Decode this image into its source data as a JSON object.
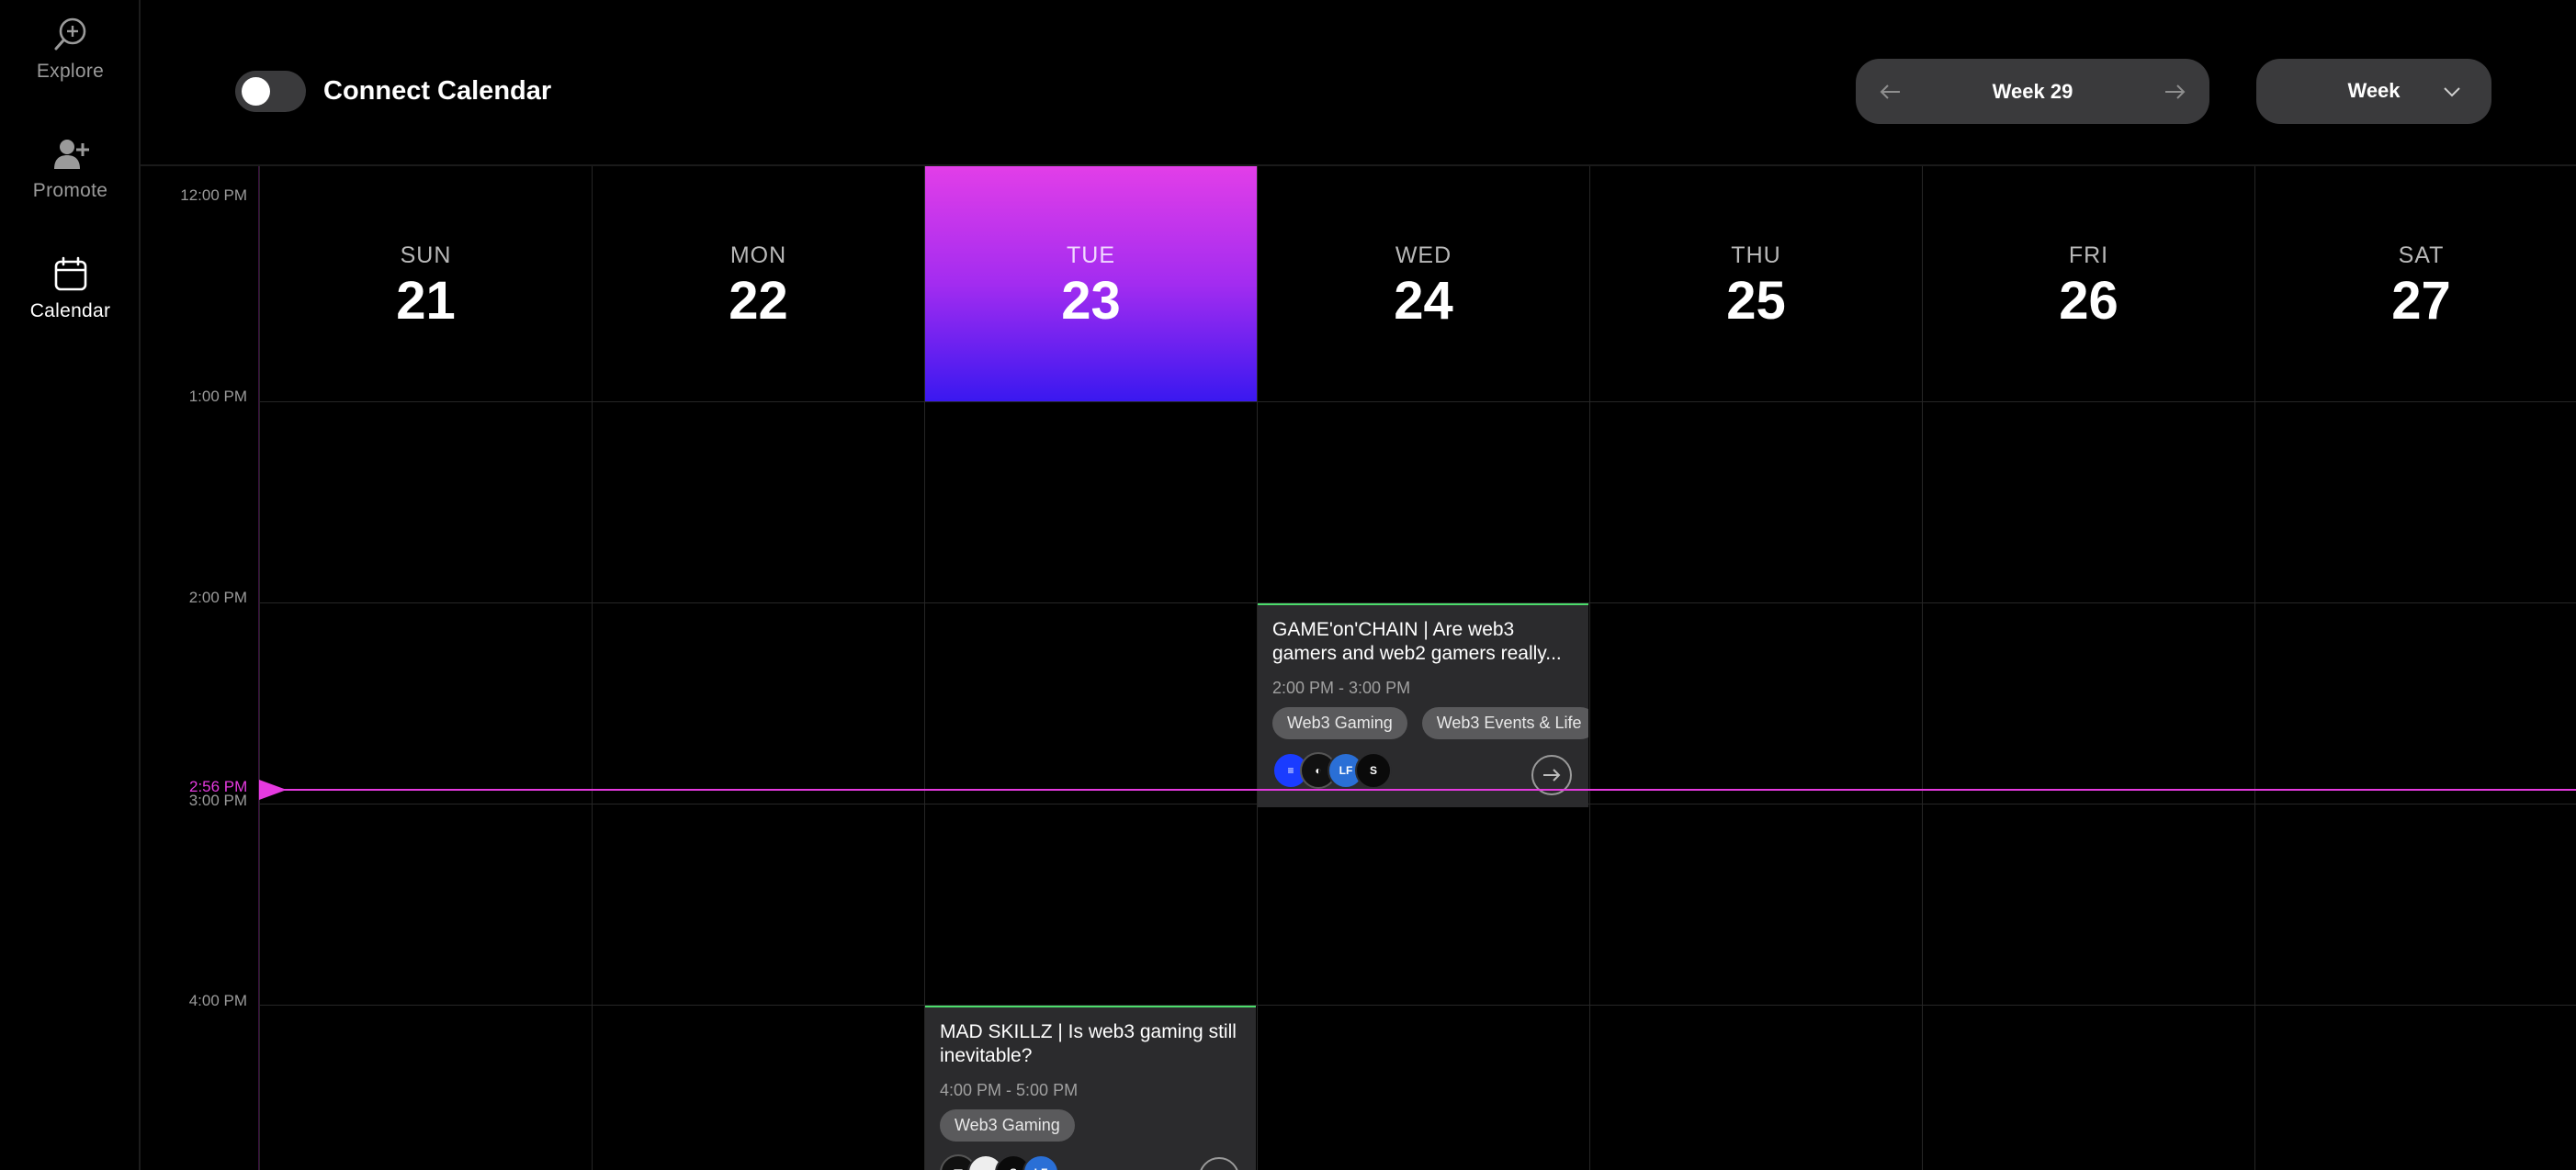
{
  "sidebar": {
    "items": [
      {
        "label": "Explore",
        "icon": "explore-icon"
      },
      {
        "label": "Promote",
        "icon": "add-user-icon"
      },
      {
        "label": "Calendar",
        "icon": "calendar-icon"
      }
    ]
  },
  "toolbar": {
    "connect_calendar_label": "Connect Calendar",
    "connect_calendar_enabled": false,
    "week_label": "Week 29",
    "view_label": "Week"
  },
  "calendar": {
    "days": [
      {
        "dow": "SUN",
        "num": "21"
      },
      {
        "dow": "MON",
        "num": "22"
      },
      {
        "dow": "TUE",
        "num": "23"
      },
      {
        "dow": "WED",
        "num": "24"
      },
      {
        "dow": "THU",
        "num": "25"
      },
      {
        "dow": "FRI",
        "num": "26"
      },
      {
        "dow": "SAT",
        "num": "27"
      }
    ],
    "today": "TUE 23",
    "times": [
      "12:00 PM",
      "1:00 PM",
      "2:00 PM",
      "3:00 PM",
      "4:00 PM"
    ],
    "now_label": "2:56 PM",
    "colors": {
      "now": "#e53adf",
      "event_border": "#4cdc6c",
      "today_top": "#e23ee8",
      "today_bottom": "#3a18f0"
    }
  },
  "events": [
    {
      "title": "GAME'on'CHAIN | Are web3 gamers and web2 gamers really...",
      "time": "2:00 PM - 3:00 PM",
      "tags": [
        "Web3 Gaming",
        "Web3 Events & Life"
      ],
      "avatars": [
        "avatar-blue",
        "avatar-dark",
        "avatar-flow",
        "avatar-s"
      ]
    },
    {
      "title": "MAD SKILLZ | Is web3 gaming still inevitable?",
      "time": "4:00 PM - 5:00 PM",
      "tags": [
        "Web3 Gaming"
      ],
      "avatars": [
        "avatar-dark",
        "avatar-white",
        "avatar-s",
        "avatar-flow"
      ]
    }
  ]
}
